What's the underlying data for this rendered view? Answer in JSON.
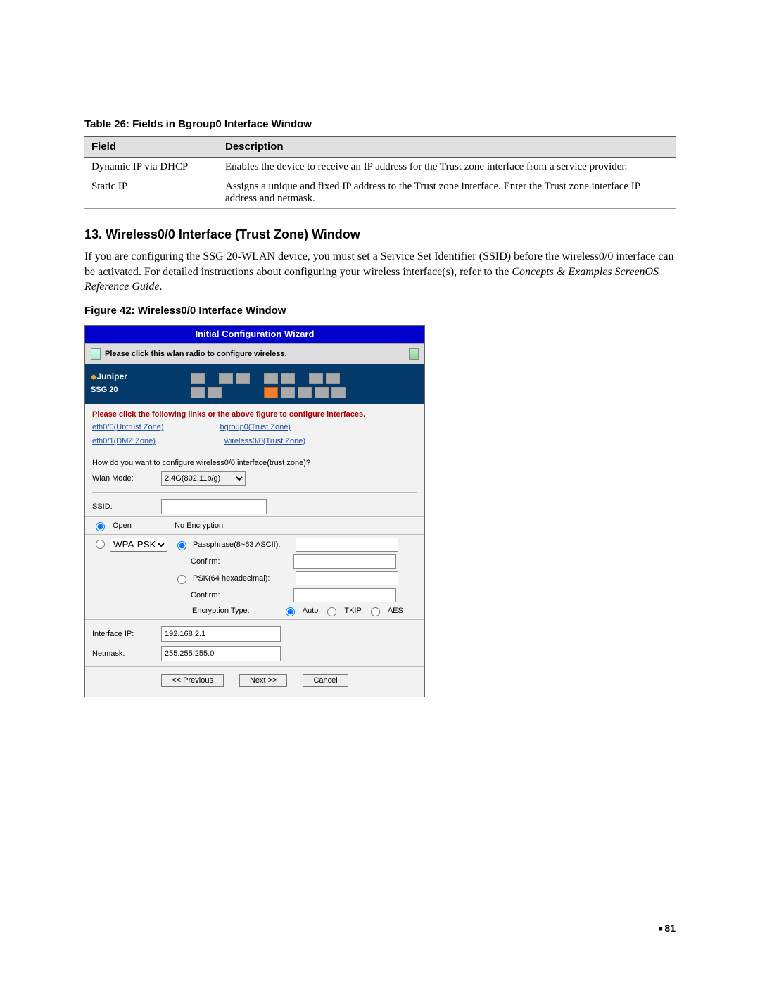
{
  "table26": {
    "caption": "Table 26:  Fields in Bgroup0 Interface Window",
    "headers": [
      "Field",
      "Description"
    ],
    "rows": [
      [
        "Dynamic IP via DHCP",
        "Enables the device to receive an IP address for the Trust zone interface from a service provider."
      ],
      [
        "Static IP",
        "Assigns a unique and fixed IP address to the Trust zone interface. Enter the Trust zone interface IP address and netmask."
      ]
    ]
  },
  "section": {
    "title": "13. Wireless0/0 Interface (Trust Zone) Window",
    "para_a": "If you are configuring the SSG 20-WLAN device, you must set a Service Set Identifier (SSID) before the wireless0/0 interface can be activated. For detailed instructions about configuring your wireless interface(s), refer to the ",
    "para_em": "Concepts & Examples ScreenOS Reference Guide",
    "para_b": "."
  },
  "figure42": {
    "caption": "Figure 42:  Wireless0/0 Interface Window"
  },
  "wizard": {
    "title": "Initial Configuration Wizard",
    "wlan_msg": "Please click this wlan radio to configure wireless.",
    "brand": "Juniper",
    "model": "SSG 20",
    "instruction": "Please click the following links or the above figure to configure interfaces.",
    "links": {
      "eth00": "eth0/0(Untrust Zone)",
      "bgroup0": "bgroup0(Trust Zone)",
      "eth01": "eth0/1(DMZ Zone)",
      "wireless00": "wireless0/0(Trust Zone)"
    },
    "question": "How do you want to configure wireless0/0 interface(trust zone)?",
    "wlan_mode_label": "Wlan Mode:",
    "wlan_mode_value": "2.4G(802.11b/g)",
    "ssid_label": "SSID:",
    "ssid_value": "",
    "open_label": "Open",
    "no_encryption": "No Encryption",
    "wpapsk_label": "WPA-PSK",
    "passphrase_label": "Passphrase(8~63 ASCII):",
    "confirm_label": "Confirm:",
    "psk_label": "PSK(64 hexadecimal):",
    "encryption_type_label": "Encryption Type:",
    "enc_auto": "Auto",
    "enc_tkip": "TKIP",
    "enc_aes": "AES",
    "interface_ip_label": "Interface IP:",
    "interface_ip_value": "192.168.2.1",
    "netmask_label": "Netmask:",
    "netmask_value": "255.255.255.0",
    "btn_prev": "<< Previous",
    "btn_next": "Next >>",
    "btn_cancel": "Cancel"
  },
  "page_number": "81"
}
